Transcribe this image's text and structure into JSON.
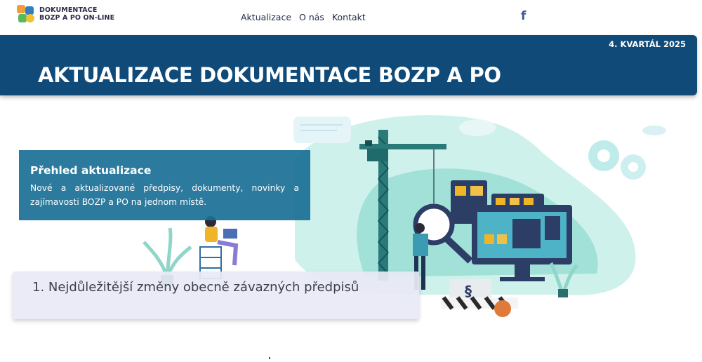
{
  "logo": {
    "line1": "DOKUMENTACE",
    "line2": "BOZP A PO ON-LINE",
    "icon": "logo-icon"
  },
  "nav": {
    "items": [
      "Aktualizace",
      "O nás",
      "Kontakt"
    ],
    "social_icon": "facebook-icon",
    "social_glyph": "f"
  },
  "banner": {
    "quarter": "4. KVARTÁL 2025",
    "title": "AKTUALIZACE DOKUMENTACE BOZP A PO"
  },
  "overview": {
    "heading": "Přehled aktualizace",
    "text": "Nové a aktualizované předpisy,  dokumenty, novinky a zajímavosti  BOZP a PO na jednom místě."
  },
  "accordion": {
    "items": [
      "1. Nejdůležitější změny obecně závazných předpisů"
    ]
  },
  "colors": {
    "banner": "#0f4a78",
    "overview": "#1a7096",
    "accent": "#7fd4cb",
    "facebook": "#3b5998"
  },
  "illustration": {
    "name": "construction-crane-illustration"
  }
}
